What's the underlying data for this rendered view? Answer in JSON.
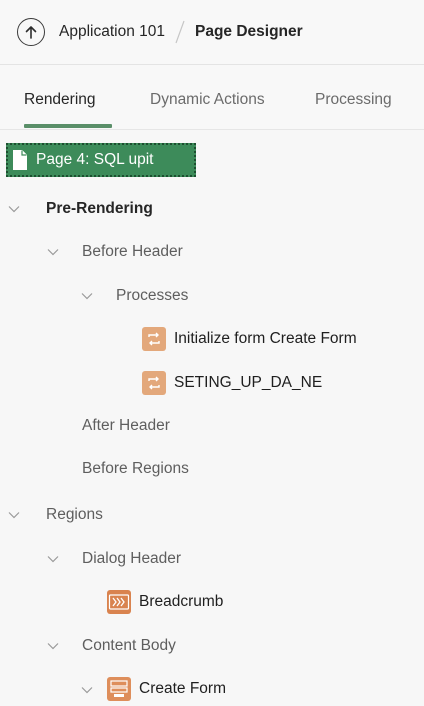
{
  "header": {
    "up_icon": "arrow-up-circle-icon",
    "application": "Application 101",
    "page": "Page Designer"
  },
  "tabs": [
    {
      "label": "Rendering",
      "active": true
    },
    {
      "label": "Dynamic Actions",
      "active": false
    },
    {
      "label": "Processing",
      "active": false
    }
  ],
  "tree": {
    "page_node": "Page 4: SQL upit",
    "pre_rendering": "Pre-Rendering",
    "before_header": "Before Header",
    "processes": "Processes",
    "process_1": "Initialize form Create Form",
    "process_2": "SETING_UP_DA_NE",
    "after_header": "After Header",
    "before_regions": "Before Regions",
    "regions": "Regions",
    "dialog_header": "Dialog Header",
    "breadcrumb": "Breadcrumb",
    "content_body": "Content Body",
    "create_form": "Create Form"
  },
  "colors": {
    "accent_green": "#3d8b5a",
    "process_icon": "#e3a87b",
    "breadcrumb_icon": "#d9834f",
    "form_icon": "#de8e5b"
  }
}
